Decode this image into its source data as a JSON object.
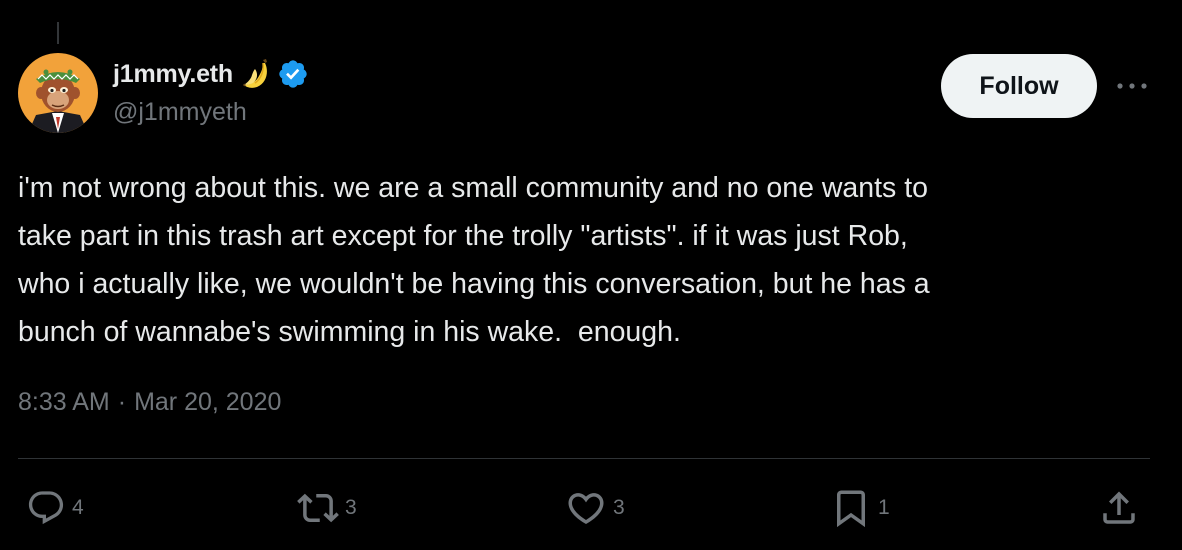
{
  "author": {
    "display_name": "j1mmy.eth",
    "handle": "@j1mmyeth",
    "badge_emoji_icon": "banana-icon",
    "verified_icon": "verified-badge-icon"
  },
  "follow_button": {
    "label": "Follow"
  },
  "tweet": {
    "text": "i'm not wrong about this. we are a small community and no one wants to\ntake part in this trash art except for the trolly \"artists\". if it was just Rob,\nwho i actually like, we wouldn't be having this conversation, but he has a\nbunch of wannabe's swimming in his wake.  enough.",
    "time": "8:33 AM",
    "separator": "·",
    "date": "Mar 20, 2020"
  },
  "actions": {
    "replies": "4",
    "reposts": "3",
    "likes": "3",
    "bookmarks": "1"
  },
  "colors": {
    "background": "#000000",
    "text": "#e7e9ea",
    "secondary_text": "#71767b",
    "verified_blue": "#1d9bf0",
    "follow_bg": "#eff3f4",
    "divider": "#2f3336"
  }
}
